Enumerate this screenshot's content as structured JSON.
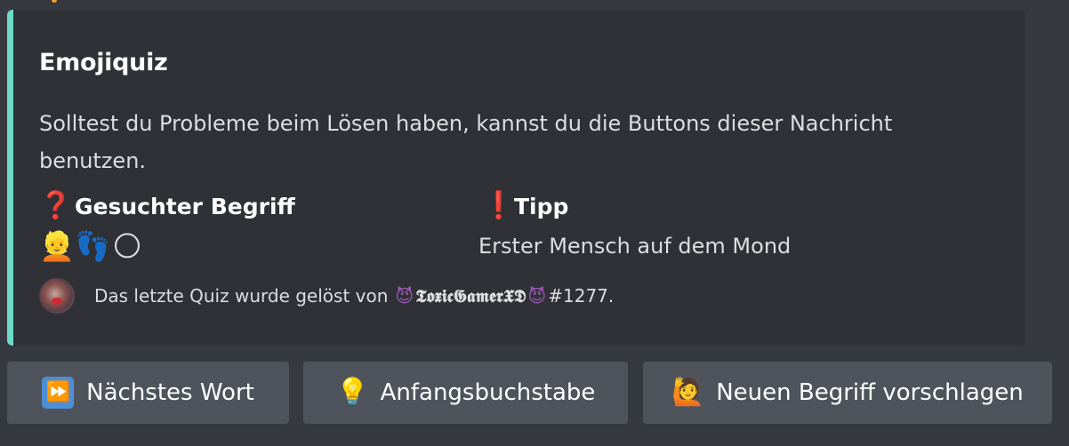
{
  "embed": {
    "accent_color": "#6ddbc7",
    "title": "Emojiquiz",
    "description": "Solltest du Probleme beim Lösen haben, kannst du die Buttons dieser Nachricht benutzen.",
    "fields": [
      {
        "icon": "question-mark-icon",
        "icon_glyph": "❓",
        "name": "Gesuchter Begriff",
        "emojis": [
          "👱",
          "👣",
          "🌕"
        ]
      },
      {
        "icon": "exclamation-mark-icon",
        "icon_glyph": "❗",
        "name": "Tipp",
        "value": "Erster Mensch auf dem Mond"
      }
    ],
    "footer": {
      "text_prefix": "Das letzte Quiz wurde gelöst von",
      "devil_glyph": "😈",
      "username": "𝕿𝖔𝖝𝖎𝖈𝕲𝖆𝖒𝖊𝖗𝖃𝕯",
      "discriminator": "#1277."
    }
  },
  "buttons": [
    {
      "icon": "fast-forward-icon",
      "icon_glyph": "⏩",
      "label": "Nächstes Wort"
    },
    {
      "icon": "light-bulb-icon",
      "icon_glyph": "💡",
      "label": "Anfangsbuchstabe"
    },
    {
      "icon": "raising-hand-icon",
      "icon_glyph": "🙋",
      "label": "Neuen Begriff vorschlagen"
    }
  ]
}
